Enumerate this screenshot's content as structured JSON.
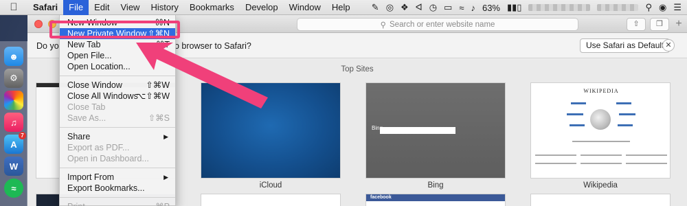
{
  "menubar": {
    "apple_icon": "",
    "items": [
      {
        "label": "Safari",
        "bold": true
      },
      {
        "label": "File",
        "active": true
      },
      {
        "label": "Edit"
      },
      {
        "label": "View"
      },
      {
        "label": "History"
      },
      {
        "label": "Bookmarks"
      },
      {
        "label": "Develop"
      },
      {
        "label": "Window"
      },
      {
        "label": "Help"
      }
    ],
    "battery": "63%"
  },
  "file_menu": {
    "items": [
      {
        "label": "New Window",
        "shortcut": "⌘N"
      },
      {
        "label": "New Private Window",
        "shortcut": "⇧⌘N",
        "highlight": true
      },
      {
        "label": "New Tab",
        "shortcut": "⌘T"
      },
      {
        "label": "Open File...",
        "shortcut": "⌘O"
      },
      {
        "label": "Open Location...",
        "shortcut": ""
      },
      {
        "separator": true
      },
      {
        "label": "Close Window",
        "shortcut": "⇧⌘W"
      },
      {
        "label": "Close All Windows",
        "shortcut": "⌥⇧⌘W"
      },
      {
        "label": "Close Tab",
        "shortcut": "",
        "disabled": true
      },
      {
        "label": "Save As...",
        "shortcut": "⇧⌘S",
        "disabled": true
      },
      {
        "separator": true
      },
      {
        "label": "Share",
        "submenu": true
      },
      {
        "label": "Export as PDF...",
        "disabled": true
      },
      {
        "label": "Open in Dashboard...",
        "disabled": true
      },
      {
        "separator": true
      },
      {
        "label": "Import From",
        "submenu": true
      },
      {
        "label": "Export Bookmarks..."
      },
      {
        "separator": true
      },
      {
        "label": "Print...",
        "shortcut": "⌘P",
        "disabled": true
      }
    ]
  },
  "browser": {
    "address_placeholder": "Search or enter website name",
    "notification": {
      "text_start": "Do yo",
      "text_end": "o browser to Safari?",
      "button": "Use Safari as Default",
      "close": "✕"
    },
    "top_sites": {
      "title": "Top Sites",
      "tiles": [
        {
          "label": ""
        },
        {
          "label": "iCloud"
        },
        {
          "label": "Bing"
        },
        {
          "label": "Wikipedia"
        }
      ],
      "bing_logo": "Bing",
      "wiki_title": "WIKIPEDIA",
      "facebook": "facebook"
    }
  },
  "colors": {
    "menu_highlight": "#2f6be0",
    "annotation": "#f0407a"
  }
}
